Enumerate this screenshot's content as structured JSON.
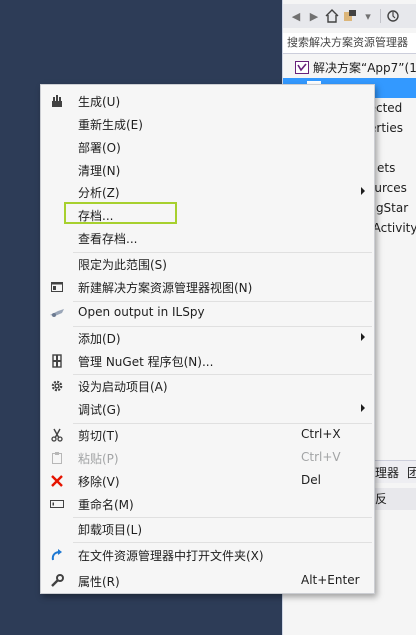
{
  "solution_explorer": {
    "search_placeholder": "搜索解决方案资源管理器",
    "tree": [
      {
        "label": "解决方案“App7”(1",
        "selected": false
      },
      {
        "label": "",
        "selected": true
      },
      {
        "label": "nected",
        "selected": false
      },
      {
        "label": "erties",
        "selected": false
      },
      {
        "label": "",
        "selected": false
      },
      {
        "label": "ets",
        "selected": false
      },
      {
        "label": "ources",
        "selected": false
      },
      {
        "label": "ingStar",
        "selected": false
      },
      {
        "label": "nActivity",
        "selected": false
      }
    ],
    "tabs": [
      "理器",
      "团"
    ],
    "properties_title": "反"
  },
  "context_menu": {
    "items": {
      "build": {
        "label": "生成(U)",
        "icon": "build-icon"
      },
      "rebuild": {
        "label": "重新生成(E)"
      },
      "deploy": {
        "label": "部署(O)"
      },
      "clean": {
        "label": "清理(N)"
      },
      "analyze": {
        "label": "分析(Z)"
      },
      "archive": {
        "label": "存档..."
      },
      "view_archives": {
        "label": "查看存档..."
      },
      "scope": {
        "label": "限定为此范围(S)"
      },
      "new_view": {
        "label": "新建解决方案资源管理器视图(N)",
        "icon": "new-window-icon"
      },
      "ilspy": {
        "label": "Open output in ILSpy",
        "icon": "ilspy-icon"
      },
      "add": {
        "label": "添加(D)"
      },
      "nuget": {
        "label": "管理 NuGet 程序包(N)...",
        "icon": "nuget-icon"
      },
      "startup": {
        "label": "设为启动项目(A)",
        "icon": "gear-icon"
      },
      "debug": {
        "label": "调试(G)"
      },
      "cut": {
        "label": "剪切(T)",
        "shortcut": "Ctrl+X",
        "icon": "scissors-icon"
      },
      "paste": {
        "label": "粘贴(P)",
        "shortcut": "Ctrl+V",
        "icon": "paste-icon"
      },
      "remove": {
        "label": "移除(V)",
        "shortcut": "Del",
        "icon": "red-x-icon"
      },
      "rename": {
        "label": "重命名(M)",
        "icon": "rename-icon"
      },
      "unload": {
        "label": "卸载项目(L)"
      },
      "open_folder": {
        "label": "在文件资源管理器中打开文件夹(X)",
        "icon": "open-folder-arrow-icon"
      },
      "properties": {
        "label": "属性(R)",
        "shortcut": "Alt+Enter",
        "icon": "wrench-icon"
      }
    },
    "highlight_color": "#a7d02e"
  }
}
